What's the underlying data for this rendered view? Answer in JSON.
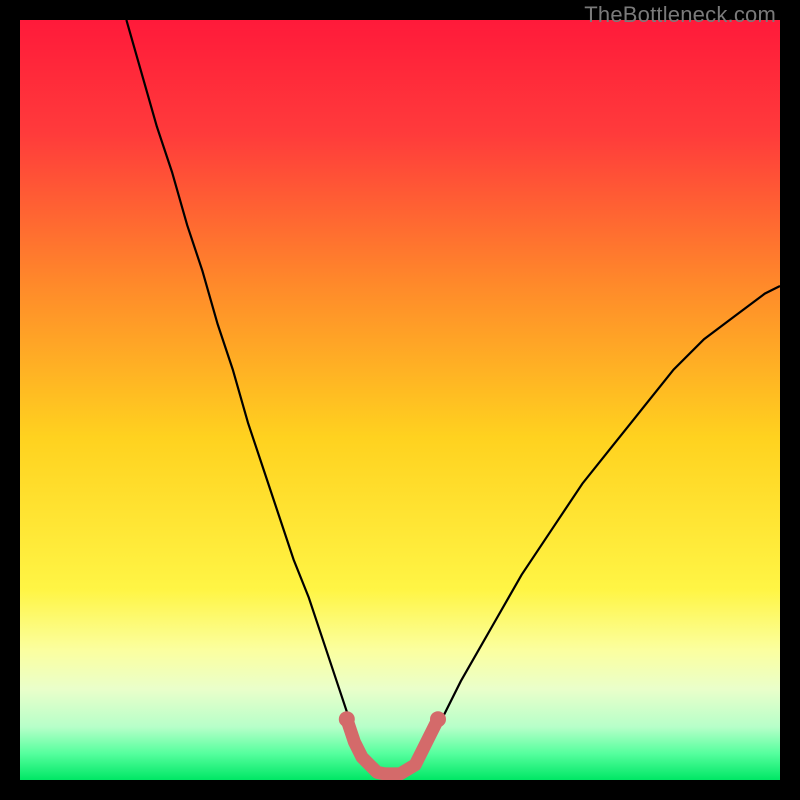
{
  "watermark": "TheBottleneck.com",
  "colors": {
    "gradient_stops": [
      {
        "offset": 0.0,
        "color": "#ff1a3a"
      },
      {
        "offset": 0.15,
        "color": "#ff3b3b"
      },
      {
        "offset": 0.35,
        "color": "#ff8a2a"
      },
      {
        "offset": 0.55,
        "color": "#ffd21f"
      },
      {
        "offset": 0.75,
        "color": "#fff545"
      },
      {
        "offset": 0.83,
        "color": "#fbffa0"
      },
      {
        "offset": 0.88,
        "color": "#eaffca"
      },
      {
        "offset": 0.93,
        "color": "#b7ffc9"
      },
      {
        "offset": 0.965,
        "color": "#56ff9e"
      },
      {
        "offset": 1.0,
        "color": "#00e765"
      }
    ],
    "curve": "#000000",
    "highlight": "#d46a6a",
    "frame": "#000000"
  },
  "chart_data": {
    "type": "line",
    "title": "",
    "xlabel": "",
    "ylabel": "",
    "xlim": [
      0,
      100
    ],
    "ylim": [
      0,
      100
    ],
    "grid": false,
    "legend": false,
    "series": [
      {
        "name": "curve",
        "x": [
          14,
          16,
          18,
          20,
          22,
          24,
          26,
          28,
          30,
          32,
          34,
          36,
          38,
          40,
          42,
          43,
          44,
          45,
          46,
          48,
          50,
          52,
          54,
          56,
          58,
          62,
          66,
          70,
          74,
          78,
          82,
          86,
          90,
          94,
          98,
          100
        ],
        "y": [
          100,
          93,
          86,
          80,
          73,
          67,
          60,
          54,
          47,
          41,
          35,
          29,
          24,
          18,
          12,
          9,
          6,
          4,
          2,
          0.5,
          0.5,
          2,
          5,
          9,
          13,
          20,
          27,
          33,
          39,
          44,
          49,
          54,
          58,
          61,
          64,
          65
        ]
      },
      {
        "name": "highlight",
        "x": [
          43,
          44,
          45,
          46,
          47,
          48,
          50,
          52,
          53,
          54,
          55
        ],
        "y": [
          8,
          5,
          3,
          2,
          1,
          0.8,
          0.8,
          2,
          4,
          6,
          8
        ]
      }
    ]
  }
}
